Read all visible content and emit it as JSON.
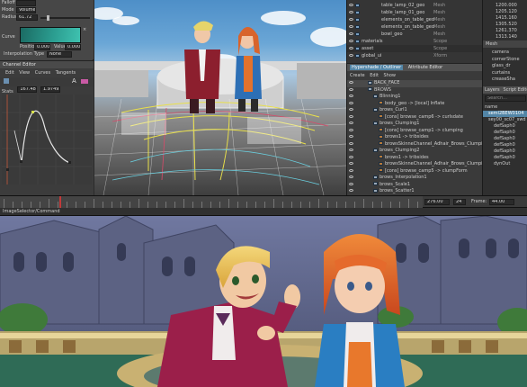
{
  "left_panel": {
    "attrs": [
      {
        "label": "Falloff",
        "value": ""
      },
      {
        "label": "Mode",
        "value": "Volume"
      },
      {
        "label": "Radius",
        "value": "61.72"
      }
    ],
    "curve_label": "Curve",
    "position_label": "Position",
    "position_value": "0.000",
    "value_label": "Value",
    "value_value": "0.000",
    "interp_label": "Interpolation Type",
    "interp_value": "None",
    "channel_editor_title": "Channel Editor",
    "menus": [
      "Edit",
      "View",
      "Curves",
      "Tangents"
    ],
    "stats_label": "Stats",
    "stats_value_1": "167.483",
    "stats_value_2": "1.97492"
  },
  "viewport": {
    "sky_color": "#5d9bd0",
    "clouds": true
  },
  "attr_list": {
    "rows": [
      {
        "name": "table_lamp_02_geo",
        "type": "Mesh"
      },
      {
        "name": "table_lamp_01_geo",
        "type": "Mesh"
      },
      {
        "name": "elements_on_table_geo",
        "type": "Mesh"
      },
      {
        "name": "elements_on_table_geo",
        "type": "Mesh"
      },
      {
        "name": "bowl_geo",
        "type": "Mesh"
      },
      {
        "name": "materials",
        "type": "Scope"
      },
      {
        "name": "asset",
        "type": "Scope"
      },
      {
        "name": "global_ui",
        "type": "Xform"
      }
    ]
  },
  "outliner": {
    "tab_outliner": "Hypershade / Outliner",
    "tab_attr": "Attribute Editor",
    "menus": [
      "Create",
      "Edit",
      "Show"
    ],
    "rows": [
      {
        "indent": 0,
        "name": "BACK_FACE"
      },
      {
        "indent": 0,
        "name": "BROWS"
      },
      {
        "indent": 1,
        "name": "Blinning1"
      },
      {
        "indent": 2,
        "name": "body_geo -> [local] Inflate"
      },
      {
        "indent": 1,
        "name": "brows_Curl1"
      },
      {
        "indent": 2,
        "name": "[cons] browse_camp6 -> curlsdate"
      },
      {
        "indent": 1,
        "name": "brows_Clumping1"
      },
      {
        "indent": 2,
        "name": "[cons] browse_camp1 -> clumping"
      },
      {
        "indent": 2,
        "name": "brows1 -> tribsides"
      },
      {
        "indent": 2,
        "name": "browsSkinneChannel_Adhair_Brows_Clumping1/clumping"
      },
      {
        "indent": 1,
        "name": "brows_Clumping2"
      },
      {
        "indent": 2,
        "name": "brows1 -> tribsides"
      },
      {
        "indent": 2,
        "name": "browsSkinneChannel_Adhair_Brows_Clumping2/clumping"
      },
      {
        "indent": 2,
        "name": "[cons] browse_camp5 -> clumpForm"
      },
      {
        "indent": 1,
        "name": "brows_Interpolation1"
      },
      {
        "indent": 1,
        "name": "brows_Scale1"
      },
      {
        "indent": 1,
        "name": "brows_Scatter1"
      }
    ]
  },
  "far_right": {
    "values": [
      "1200.000",
      "1205.120",
      "1415.160",
      "1305.520",
      "1261.370",
      "1313.140"
    ],
    "mesh_label": "Mesh",
    "mesh_items": [
      "camera",
      "cornerStone",
      "glass_dr",
      "curtains",
      "creaseSha"
    ],
    "layers_label": "Layers",
    "script_editor_label": "Script Editor",
    "search_placeholder": "Search...",
    "tree_items": [
      "name",
      "seml2BEW0104",
      "sey00_sc07_swd",
      "defSaph0",
      "defSaph0",
      "defSaph0",
      "defSaph0",
      "defSaph0",
      "defSaph0",
      "dynOut"
    ]
  },
  "timeline": {
    "current_frame": "276.00",
    "frame_step": "24",
    "frame_label": "Frame:",
    "frame_value": "44.00"
  },
  "command_bar": {
    "label": "ImageSelector/Command"
  }
}
